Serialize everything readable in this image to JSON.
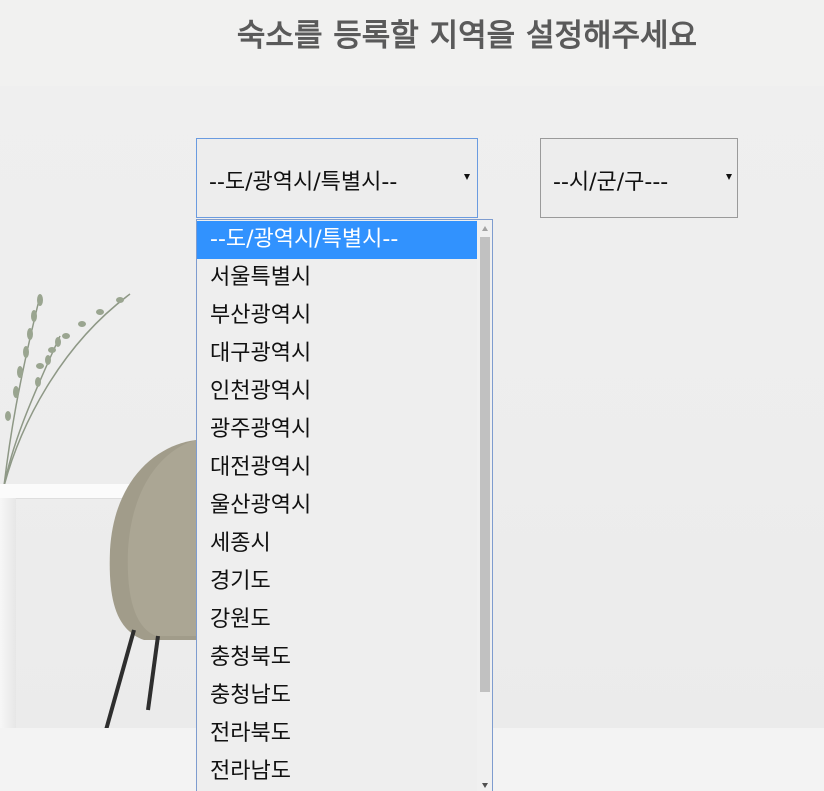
{
  "page": {
    "title": "숙소를 등록할 지역을 설정해주세요"
  },
  "province_select": {
    "value": "--도/광역시/특별시--",
    "options": [
      "--도/광역시/특별시--",
      "서울특별시",
      "부산광역시",
      "대구광역시",
      "인천광역시",
      "광주광역시",
      "대전광역시",
      "울산광역시",
      "세종시",
      "경기도",
      "강원도",
      "충청북도",
      "충청남도",
      "전라북도",
      "전라남도"
    ],
    "highlighted": "--도/광역시/특별시--"
  },
  "city_select": {
    "value": "--시/군/구---"
  },
  "colors": {
    "highlight": "#3192fe",
    "title_text": "#5a5a5a",
    "focus_border": "#6a9be0"
  },
  "icons": {
    "select_arrow": "triangle-down",
    "scroll_up": "triangle-up",
    "scroll_down": "triangle-down"
  }
}
